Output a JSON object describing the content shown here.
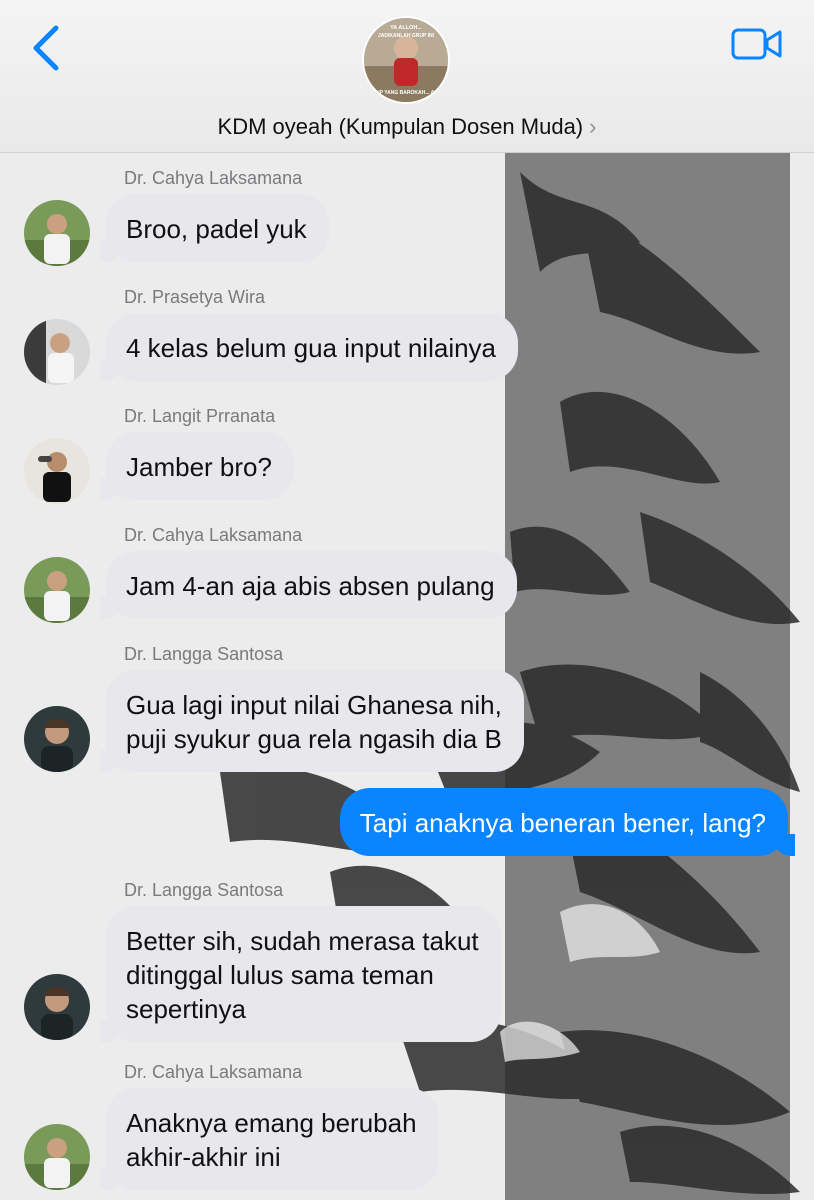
{
  "header": {
    "group_name": "KDM oyeah (Kumpulan Dosen Muda)",
    "chevron": "›",
    "back_icon": "chevron-left-icon",
    "video_icon": "video-camera-icon",
    "avatar_text_top": "YA ALLOH...",
    "avatar_text_mid": "JADIKANLAH GRUP INI",
    "avatar_text_bottom": "GRUP YANG BAROKAH... AMIN",
    "accent_color": "#0b84ff"
  },
  "messages": [
    {
      "sender": "Dr. Cahya Laksamana",
      "text": "Broo, padel yuk"
    },
    {
      "sender": "Dr. Prasetya Wira",
      "text": "4 kelas belum gua input nilainya"
    },
    {
      "sender": "Dr. Langit Prranata",
      "text": "Jamber bro?"
    },
    {
      "sender": "Dr. Cahya Laksamana",
      "text": "Jam 4-an aja abis absen pulang"
    },
    {
      "sender": "Dr. Langga Santosa",
      "text": "Gua lagi input nilai Ghanesa nih,\npuji syukur gua rela ngasih dia B"
    },
    {
      "sender": "",
      "text": "Tapi anaknya beneran bener, lang?"
    },
    {
      "sender": "Dr. Langga Santosa",
      "text": "Better sih, sudah merasa takut\nditinggal lulus sama teman\nsepertinya"
    },
    {
      "sender": "Dr. Cahya Laksamana",
      "text": "Anaknya emang berubah\nakhir-akhir ini"
    }
  ]
}
